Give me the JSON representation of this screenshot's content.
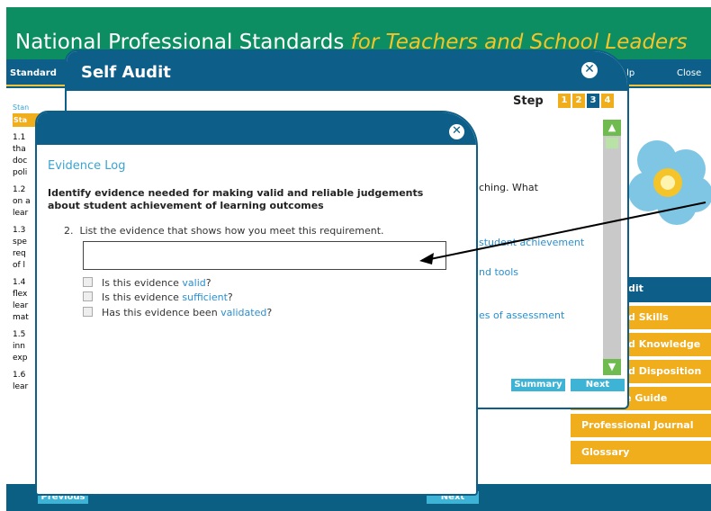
{
  "banner": {
    "title_main": "National Professional Standards ",
    "title_accent": "for Teachers and School Leaders"
  },
  "nav": {
    "standard": "Standard",
    "help": "Help",
    "close": "Close"
  },
  "background": {
    "crumb": "Stan",
    "header": "Sta",
    "blocks": [
      {
        "lines": [
          "1.1",
          "tha",
          "doc",
          "poli"
        ]
      },
      {
        "lines": [
          "1.2",
          "on a",
          "lear"
        ]
      },
      {
        "lines": [
          "1.3",
          "spe",
          "req",
          "of l"
        ]
      },
      {
        "lines": [
          "1.4",
          "flex",
          "lear",
          "mat"
        ]
      },
      {
        "lines": [
          "1.5",
          "inn",
          "exp"
        ]
      },
      {
        "lines": [
          "1.6",
          "lear"
        ]
      }
    ],
    "right_menu": [
      {
        "label": "Self Audit",
        "visible": "dit"
      },
      {
        "label": "d Skills"
      },
      {
        "label": "d Knowledge"
      },
      {
        "label": "d Disposition"
      },
      {
        "label": "Evidence Guide"
      },
      {
        "label": "Professional Journal"
      },
      {
        "label": "Glossary"
      }
    ],
    "footer": {
      "previous": "Previous",
      "next": "Next"
    }
  },
  "self_audit": {
    "title": "Self Audit",
    "step_label": "Step",
    "steps": [
      "1",
      "2",
      "3",
      "4"
    ],
    "active_step": "3",
    "snippets": [
      "ching.  What",
      "student achievement",
      "nd tools",
      "es of assessment"
    ],
    "summary": "Summary",
    "next": "Next",
    "accent": "#0d5f8a"
  },
  "evidence_log": {
    "title": "Evidence Log",
    "heading": "Identify evidence needed for making valid and reliable judgements about student achievement of learning outcomes",
    "question_number": "2.",
    "question": "List the evidence that shows how you meet this requirement.",
    "input_value": "",
    "checks": [
      {
        "pre": "Is this evidence ",
        "link": "valid",
        "post": "?"
      },
      {
        "pre": "Is this evidence ",
        "link": "sufficient",
        "post": "?"
      },
      {
        "pre": "Has this evidence been ",
        "link": "validated",
        "post": "?"
      }
    ]
  },
  "colors": {
    "teal_blue": "#0d5f8a",
    "banner_green": "#0c8d62",
    "orange": "#f0ad1c",
    "link": "#2a8fd0"
  }
}
